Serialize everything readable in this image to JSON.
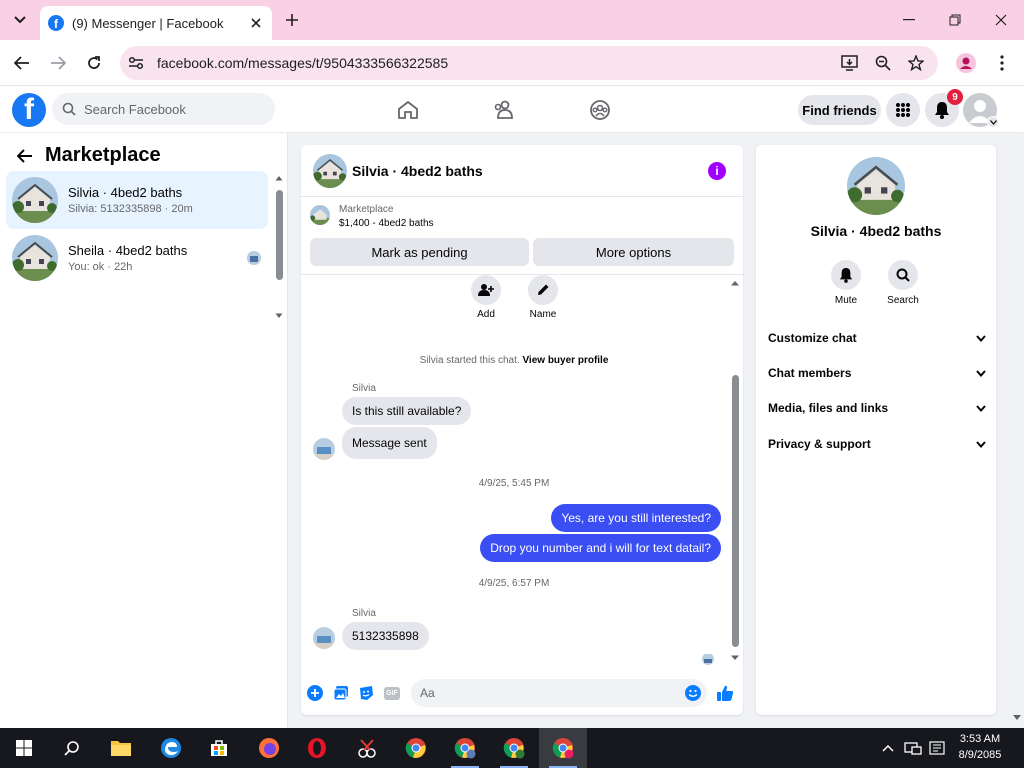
{
  "browser": {
    "tab_title": "(9) Messenger | Facebook",
    "url": "facebook.com/messages/t/9504333566322585"
  },
  "fb_header": {
    "search_placeholder": "Search Facebook",
    "find_friends_label": "Find friends",
    "notification_count": "9"
  },
  "left_panel": {
    "title": "Marketplace",
    "conversations": [
      {
        "name": "Silvia · 4bed2 baths",
        "preview": "Silvia: 5132335898 · 20m"
      },
      {
        "name": "Sheila · 4bed2 baths",
        "preview": "You: ok · 22h"
      }
    ]
  },
  "chat": {
    "title": "Silvia · 4bed2 baths",
    "marketplace_label": "Marketplace",
    "marketplace_detail": "$1,400 - 4bed2 baths",
    "mark_pending_label": "Mark as pending",
    "more_options_label": "More options",
    "actions": {
      "add_label": "Add",
      "name_label": "Name"
    },
    "system_text": "Silvia started this chat.",
    "buyer_profile_link": "View buyer profile",
    "messages": [
      {
        "sender": "Silvia",
        "text": "Is this still available?"
      },
      {
        "text": "Message sent"
      },
      {
        "timestamp": "4/9/25, 5:45 PM"
      },
      {
        "text": "Yes, are you still interested?"
      },
      {
        "text": "Drop you number and i will for text datail?"
      },
      {
        "timestamp": "4/9/25, 6:57 PM"
      },
      {
        "sender": "Silvia",
        "text": "5132335898"
      }
    ],
    "composer_placeholder": "Aa",
    "gif_label": "GIF"
  },
  "info_panel": {
    "name": "Silvia · 4bed2 baths",
    "mute_label": "Mute",
    "search_label": "Search",
    "sections": [
      "Customize chat",
      "Chat members",
      "Media, files and links",
      "Privacy & support"
    ]
  },
  "taskbar": {
    "time": "3:53 AM",
    "date": "8/9/2085"
  },
  "colors": {
    "facebook_blue": "#1877f2",
    "outgoing_bubble": "#3a4ef4",
    "info_purple": "#a100ff",
    "notification_red": "#e41e3f",
    "tab_strip_pink": "#f9d0e4"
  }
}
